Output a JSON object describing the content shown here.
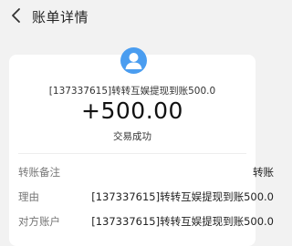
{
  "header": {
    "title": "账单详情",
    "back_icon": "chevron-left-icon"
  },
  "detail": {
    "avatar_icon": "user-avatar-icon",
    "description": "[137337615]转转互娱提现到账500.0",
    "amount": "+500.00",
    "status": "交易成功"
  },
  "rows": [
    {
      "label": "转账备注",
      "value": "转账"
    },
    {
      "label": "理由",
      "value": "[137337615]转转互娱提现到账500.0"
    },
    {
      "label": "对方账户",
      "value": "[137337615]转转互娱提现到账500.0"
    }
  ],
  "colors": {
    "background": "#f2f2f2",
    "card": "#ffffff",
    "avatar": "#4a9df0"
  }
}
